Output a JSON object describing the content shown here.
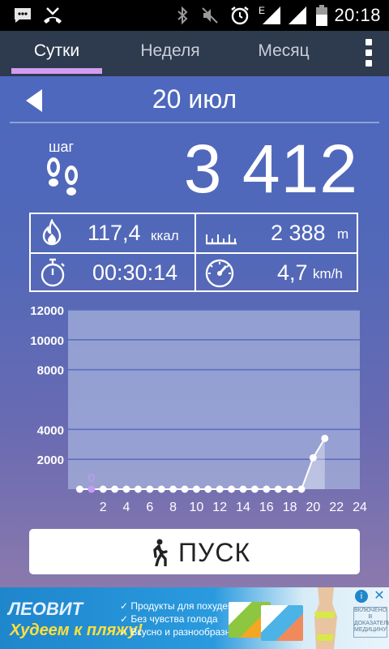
{
  "status_bar": {
    "time": "20:18",
    "network_type": "E",
    "icons": [
      "message-icon",
      "missed-call-icon",
      "bluetooth-icon",
      "mute-icon",
      "alarm-icon",
      "signal-icon",
      "signal-icon",
      "battery-icon"
    ]
  },
  "tabs": [
    {
      "label": "Сутки",
      "active": true
    },
    {
      "label": "Неделя",
      "active": false
    },
    {
      "label": "Месяц",
      "active": false
    }
  ],
  "header": {
    "date": "20 июл"
  },
  "steps": {
    "label": "шаг",
    "count": "3 412"
  },
  "stats": {
    "calories": {
      "value": "117,4",
      "unit": "ккал"
    },
    "distance": {
      "value": "2 388",
      "unit": "m"
    },
    "duration": {
      "value": "00:30:14"
    },
    "speed": {
      "value": "4,7",
      "unit": "km/h"
    }
  },
  "chart_data": {
    "type": "line",
    "x": [
      0,
      1,
      2,
      3,
      4,
      5,
      6,
      7,
      8,
      9,
      10,
      11,
      12,
      13,
      14,
      15,
      16,
      17,
      18,
      19,
      20,
      21
    ],
    "values": [
      0,
      0,
      0,
      0,
      0,
      0,
      0,
      0,
      0,
      0,
      0,
      0,
      0,
      0,
      0,
      0,
      0,
      0,
      0,
      0,
      2100,
      3400
    ],
    "xticks": [
      "2",
      "4",
      "6",
      "8",
      "10",
      "12",
      "14",
      "16",
      "18",
      "20",
      "22",
      "24"
    ],
    "yticks": [
      "2000",
      "4000",
      "8000",
      "10000",
      "12000"
    ],
    "xlim": [
      -1,
      24
    ],
    "ylim": [
      0,
      12000
    ],
    "highlight": {
      "x": 1,
      "label": "0"
    },
    "grid": true,
    "colors": {
      "plot_bg": "#a6b2dc",
      "grid": "#5b6fc0",
      "line": "#ffffff",
      "highlight": "#c79cf0"
    }
  },
  "start_button": {
    "label": "ПУСК"
  },
  "ad": {
    "brand": "ЛЕОВИТ",
    "slogan": "Худеем к пляжу!",
    "bullets": [
      "✓ Продукты для похудения",
      "✓ Без чувства голода",
      "✓ Вкусно и разнообразно"
    ],
    "stamp": "ВКЛЮЧЕНО В ДОКАЗАТЕЛЬНУЮ МЕДИЦИНУ"
  },
  "colors": {
    "accent": "#d39df0",
    "tab_bar": "#2e3a4e"
  }
}
